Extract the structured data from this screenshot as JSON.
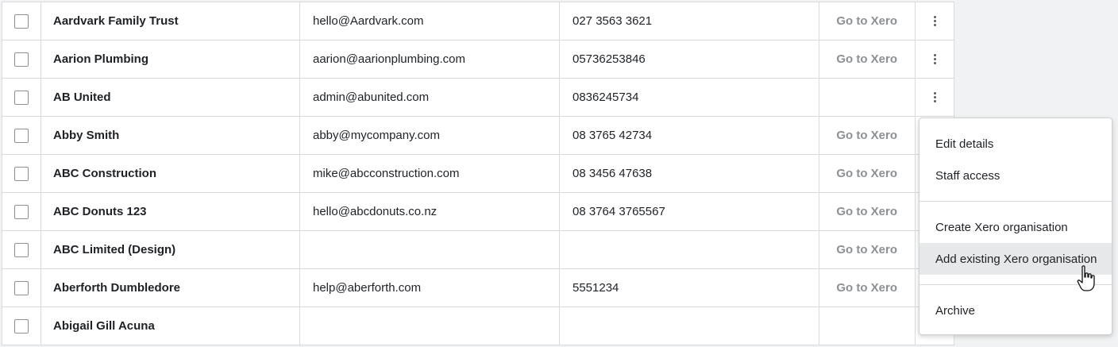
{
  "rows": [
    {
      "name": "Aardvark Family Trust",
      "email": "hello@Aardvark.com",
      "phone": "027 3563 3621",
      "link": "Go to Xero",
      "menu": true
    },
    {
      "name": "Aarion Plumbing",
      "email": "aarion@aarionplumbing.com",
      "phone": "05736253846",
      "link": "Go to Xero",
      "menu": true
    },
    {
      "name": "AB United",
      "email": "admin@abunited.com",
      "phone": "0836245734",
      "link": "",
      "menu": true
    },
    {
      "name": "Abby Smith",
      "email": "abby@mycompany.com",
      "phone": "08 3765 42734",
      "link": "Go to Xero",
      "menu": false
    },
    {
      "name": "ABC Construction",
      "email": "mike@abcconstruction.com",
      "phone": "08 3456 47638",
      "link": "Go to Xero",
      "menu": false
    },
    {
      "name": "ABC Donuts 123",
      "email": "hello@abcdonuts.co.nz",
      "phone": "08 3764 3765567",
      "link": "Go to Xero",
      "menu": false
    },
    {
      "name": "ABC Limited (Design)",
      "email": "",
      "phone": "",
      "link": "Go to Xero",
      "menu": false
    },
    {
      "name": "Aberforth Dumbledore",
      "email": "help@aberforth.com",
      "phone": "5551234",
      "link": "Go to Xero",
      "menu": false
    },
    {
      "name": "Abigail Gill Acuna",
      "email": "",
      "phone": "",
      "link": "",
      "menu": false
    }
  ],
  "context_menu": {
    "items": [
      {
        "label": "Edit details"
      },
      {
        "label": "Staff access"
      },
      {
        "label": "Create Xero organisation"
      },
      {
        "label": "Add existing Xero organisation"
      },
      {
        "label": "Archive"
      }
    ]
  }
}
